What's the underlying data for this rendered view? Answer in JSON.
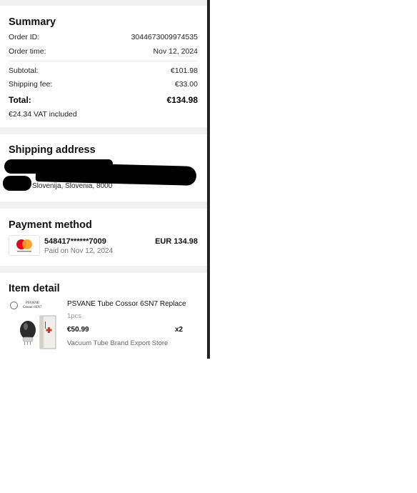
{
  "summary": {
    "title": "Summary",
    "order_id_label": "Order ID:",
    "order_id": "3044673009974535",
    "order_time_label": "Order time:",
    "order_time": "Nov 12, 2024",
    "subtotal_label": "Subtotal:",
    "subtotal": "€101.98",
    "shipping_label": "Shipping fee:",
    "shipping": "€33.00",
    "total_label": "Total:",
    "total": "€134.98",
    "vat_note": "€24.34 VAT included"
  },
  "shipping_address": {
    "title": "Shipping address",
    "line": "Slovenija, Slovenia, 8000"
  },
  "payment": {
    "title": "Payment method",
    "card_brand_icon": "mastercard-icon",
    "card_number": "548417******7009",
    "paid_on": "Paid on Nov 12, 2024",
    "amount": "EUR 134.98"
  },
  "item_detail": {
    "title": "Item detail",
    "item": {
      "name": "PSVANE Tube Cossor 6SN7 Replace",
      "qty": "1pcs",
      "price": "€50.99",
      "multiplier": "x2",
      "store": "Vacuum Tube Brand Export Store",
      "thumb_brand": "PSVANE",
      "thumb_model": "Cossor 6SN7"
    }
  }
}
